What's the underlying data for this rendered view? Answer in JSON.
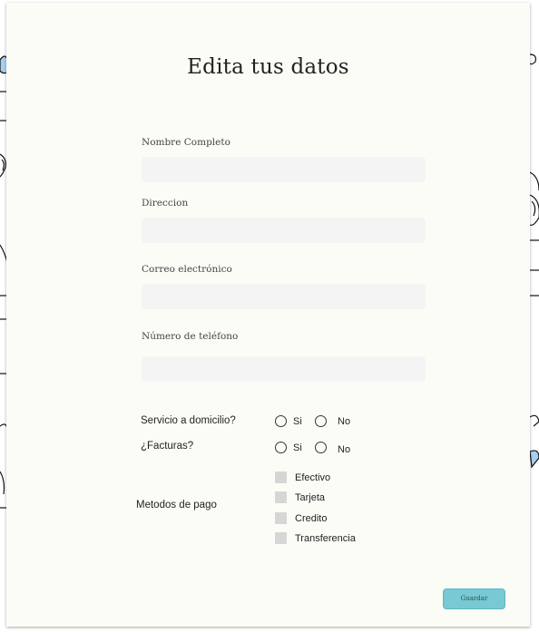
{
  "form": {
    "title": "Edita tus datos",
    "fields": [
      {
        "label": "Nombre Completo",
        "value": "",
        "placeholder": ""
      },
      {
        "label": "Direccion",
        "value": "",
        "placeholder": ""
      },
      {
        "label": "Correo electrónico",
        "value": "",
        "placeholder": ""
      },
      {
        "label": "Número de teléfono",
        "value": "",
        "placeholder": ""
      }
    ],
    "questions": [
      {
        "label": "Servicio a domicilio?",
        "yes": "Si",
        "no": "No"
      },
      {
        "label": "¿Facturas?",
        "yes": "Si",
        "no": "No"
      }
    ],
    "payment": {
      "label": "Metodos de pago",
      "options": [
        "Efectivo",
        "Tarjeta",
        "Credito",
        "Transferencia"
      ]
    },
    "save_label": "Guardar"
  },
  "colors": {
    "card_background": "#fcfcf7",
    "input_background": "#f4f4f4",
    "checkbox_fill": "#d6d6d6",
    "save_button": "#77c9d3",
    "background_doodle_fill": "#a8cfee"
  }
}
